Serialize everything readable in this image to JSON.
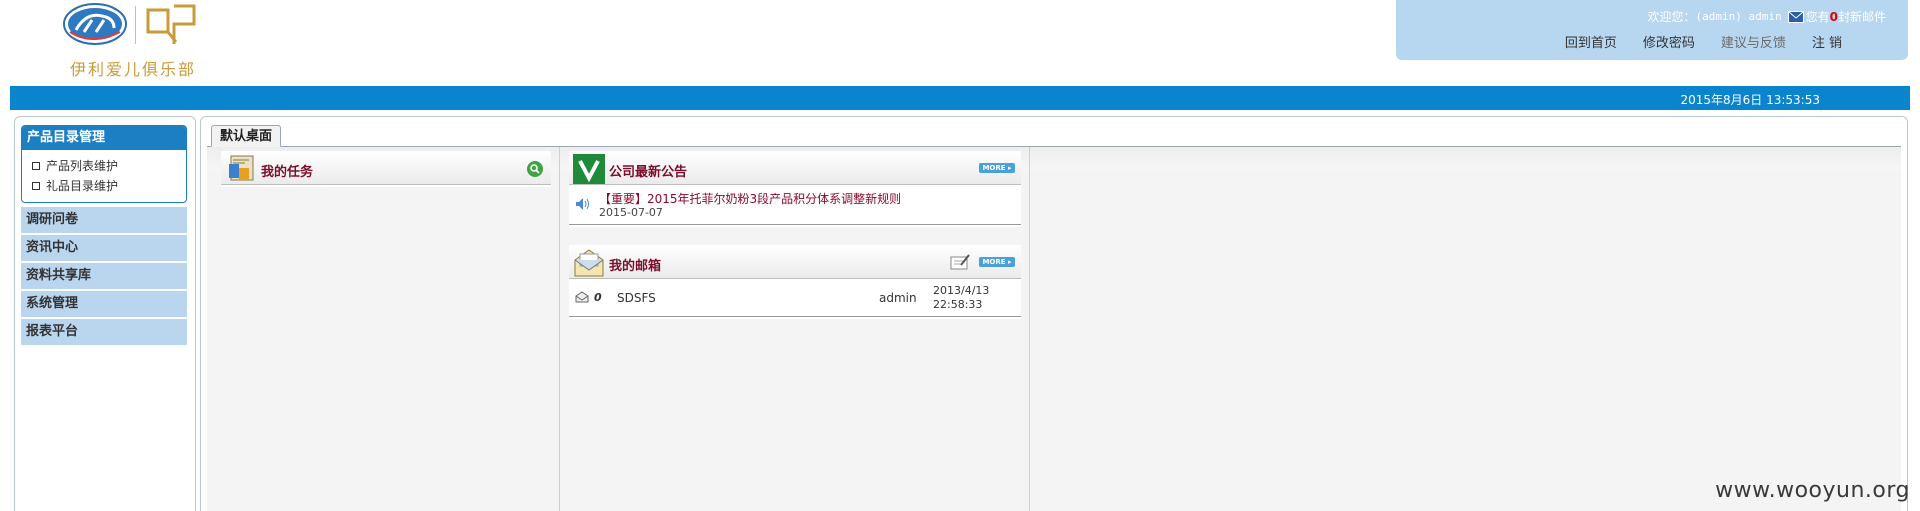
{
  "header": {
    "club_name": "伊利爱儿俱乐部",
    "welcome_prefix": "欢迎您：",
    "welcome_user": "(admin) admin",
    "mail_prefix": "您有",
    "mail_count": "0",
    "mail_suffix": "封新邮件",
    "links": [
      {
        "label": "回到首页"
      },
      {
        "label": "修改密码"
      },
      {
        "label": "建议与反馈"
      },
      {
        "label": "注 销"
      }
    ],
    "datetime": "2015年8月6日 13:53:53"
  },
  "sidebar": {
    "group_title": "产品目录管理",
    "sub_items": [
      {
        "label": "产品列表维护"
      },
      {
        "label": "礼品目录维护"
      }
    ],
    "categories": [
      {
        "label": "调研问卷"
      },
      {
        "label": "资讯中心"
      },
      {
        "label": "资料共享库"
      },
      {
        "label": "系统管理"
      },
      {
        "label": "报表平台"
      }
    ]
  },
  "main": {
    "tab_label": "默认桌面",
    "tasks": {
      "title": "我的任务"
    },
    "notice": {
      "title": "公司最新公告",
      "more_label": "MORE ▸",
      "items": [
        {
          "title": "【重要】2015年托菲尔奶粉3段产品积分体系调整新规则",
          "date": "2015-07-07"
        }
      ]
    },
    "mailbox": {
      "title": "我的邮箱",
      "more_label": "MORE ▸",
      "items": [
        {
          "attachment": "0",
          "subject": "SDSFS",
          "sender": "admin",
          "date": "2013/4/13",
          "time": "22:58:33"
        }
      ]
    }
  },
  "watermark": "www.wooyun.org",
  "colors": {
    "primary_blue": "#0a84cc",
    "light_blue": "#b9d6ee",
    "title_maroon": "#7a0f2c"
  }
}
